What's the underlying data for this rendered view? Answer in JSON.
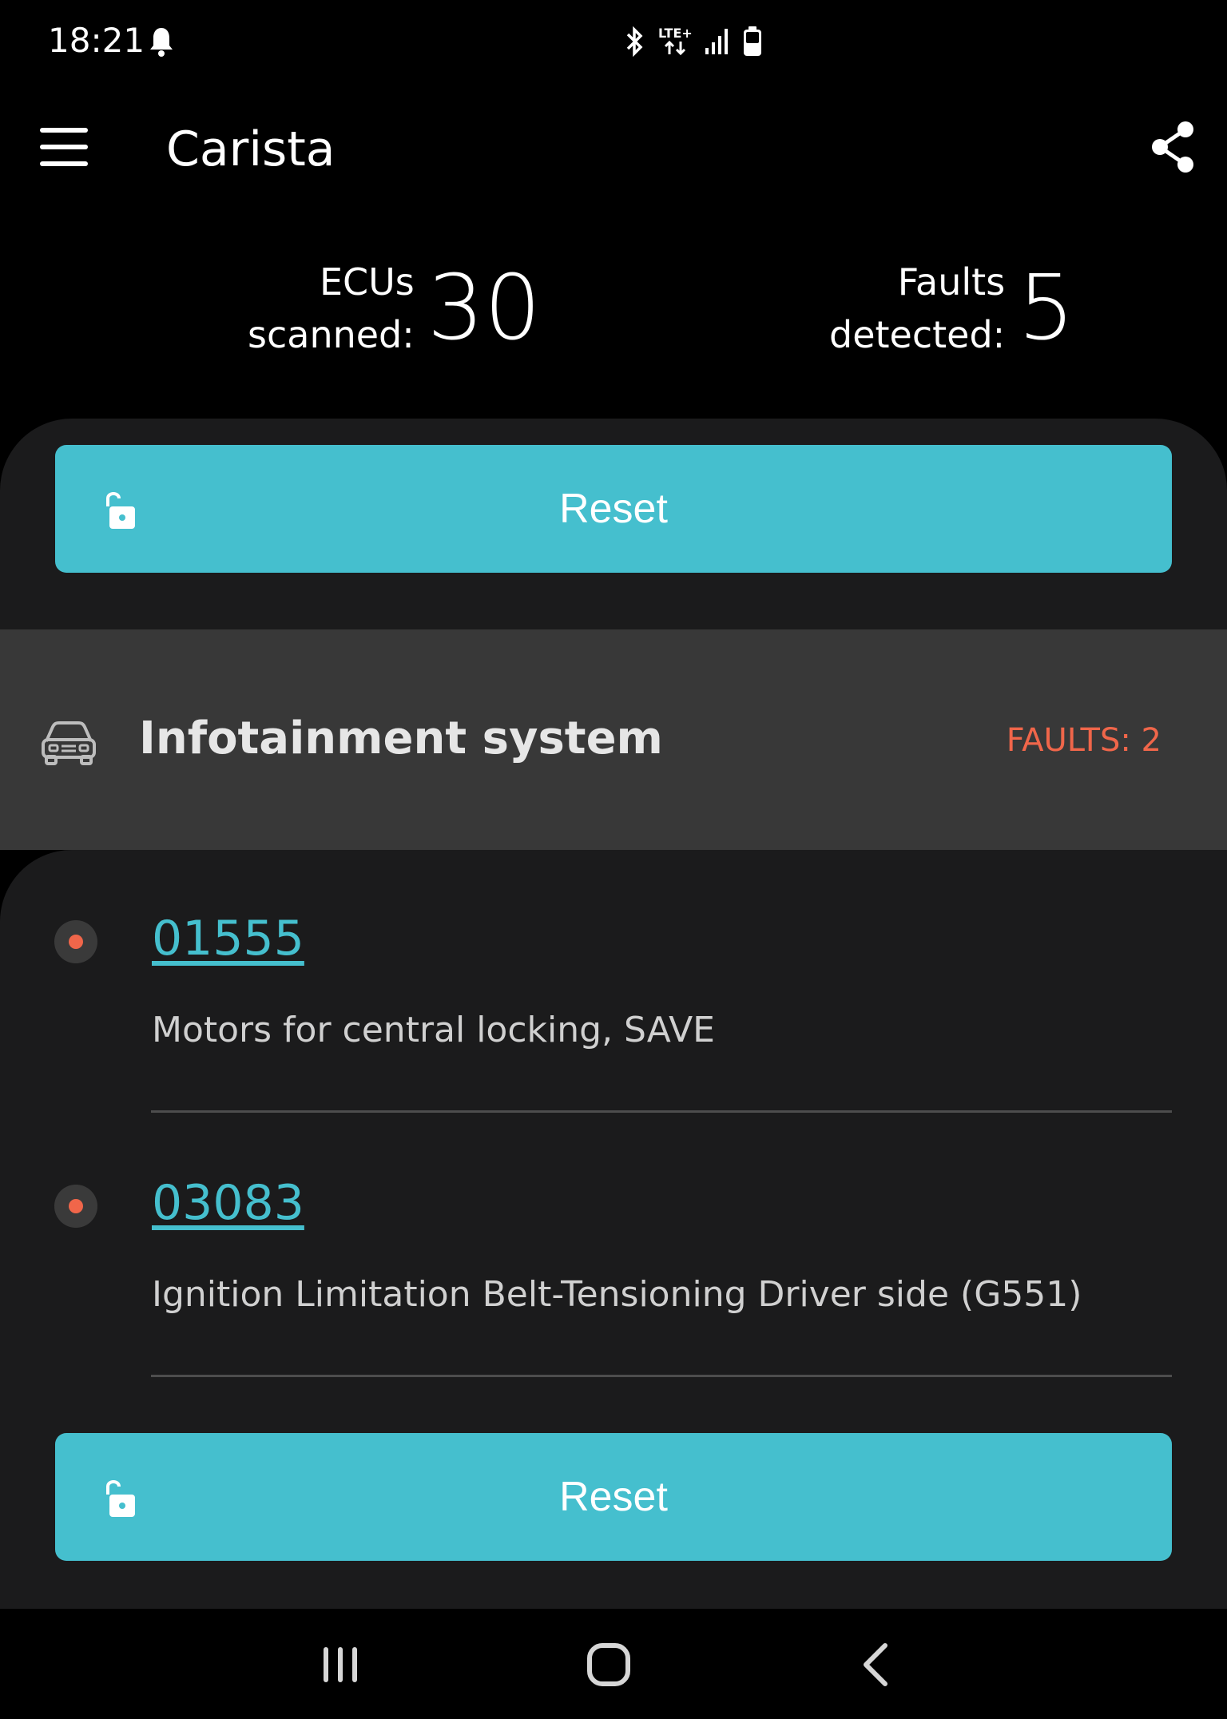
{
  "status_bar": {
    "time": "18:21",
    "network_label": "LTE+"
  },
  "app_bar": {
    "title": "Carista"
  },
  "summary": {
    "ecus_label_line1": "ECUs",
    "ecus_label_line2": "scanned:",
    "ecus_value": "30",
    "faults_label_line1": "Faults",
    "faults_label_line2": "detected:",
    "faults_value": "5"
  },
  "reset_label": "Reset",
  "section": {
    "title": "Infotainment system",
    "faults_badge": "FAULTS: 2"
  },
  "faults": [
    {
      "code": "01555",
      "description": "Motors for central locking, SAVE"
    },
    {
      "code": "03083",
      "description": "Ignition Limitation Belt-Tensioning Driver side (G551)"
    }
  ],
  "colors": {
    "accent": "#45bfce",
    "fault": "#f0664a",
    "panel": "#1b1b1c",
    "section_header": "#383838"
  }
}
